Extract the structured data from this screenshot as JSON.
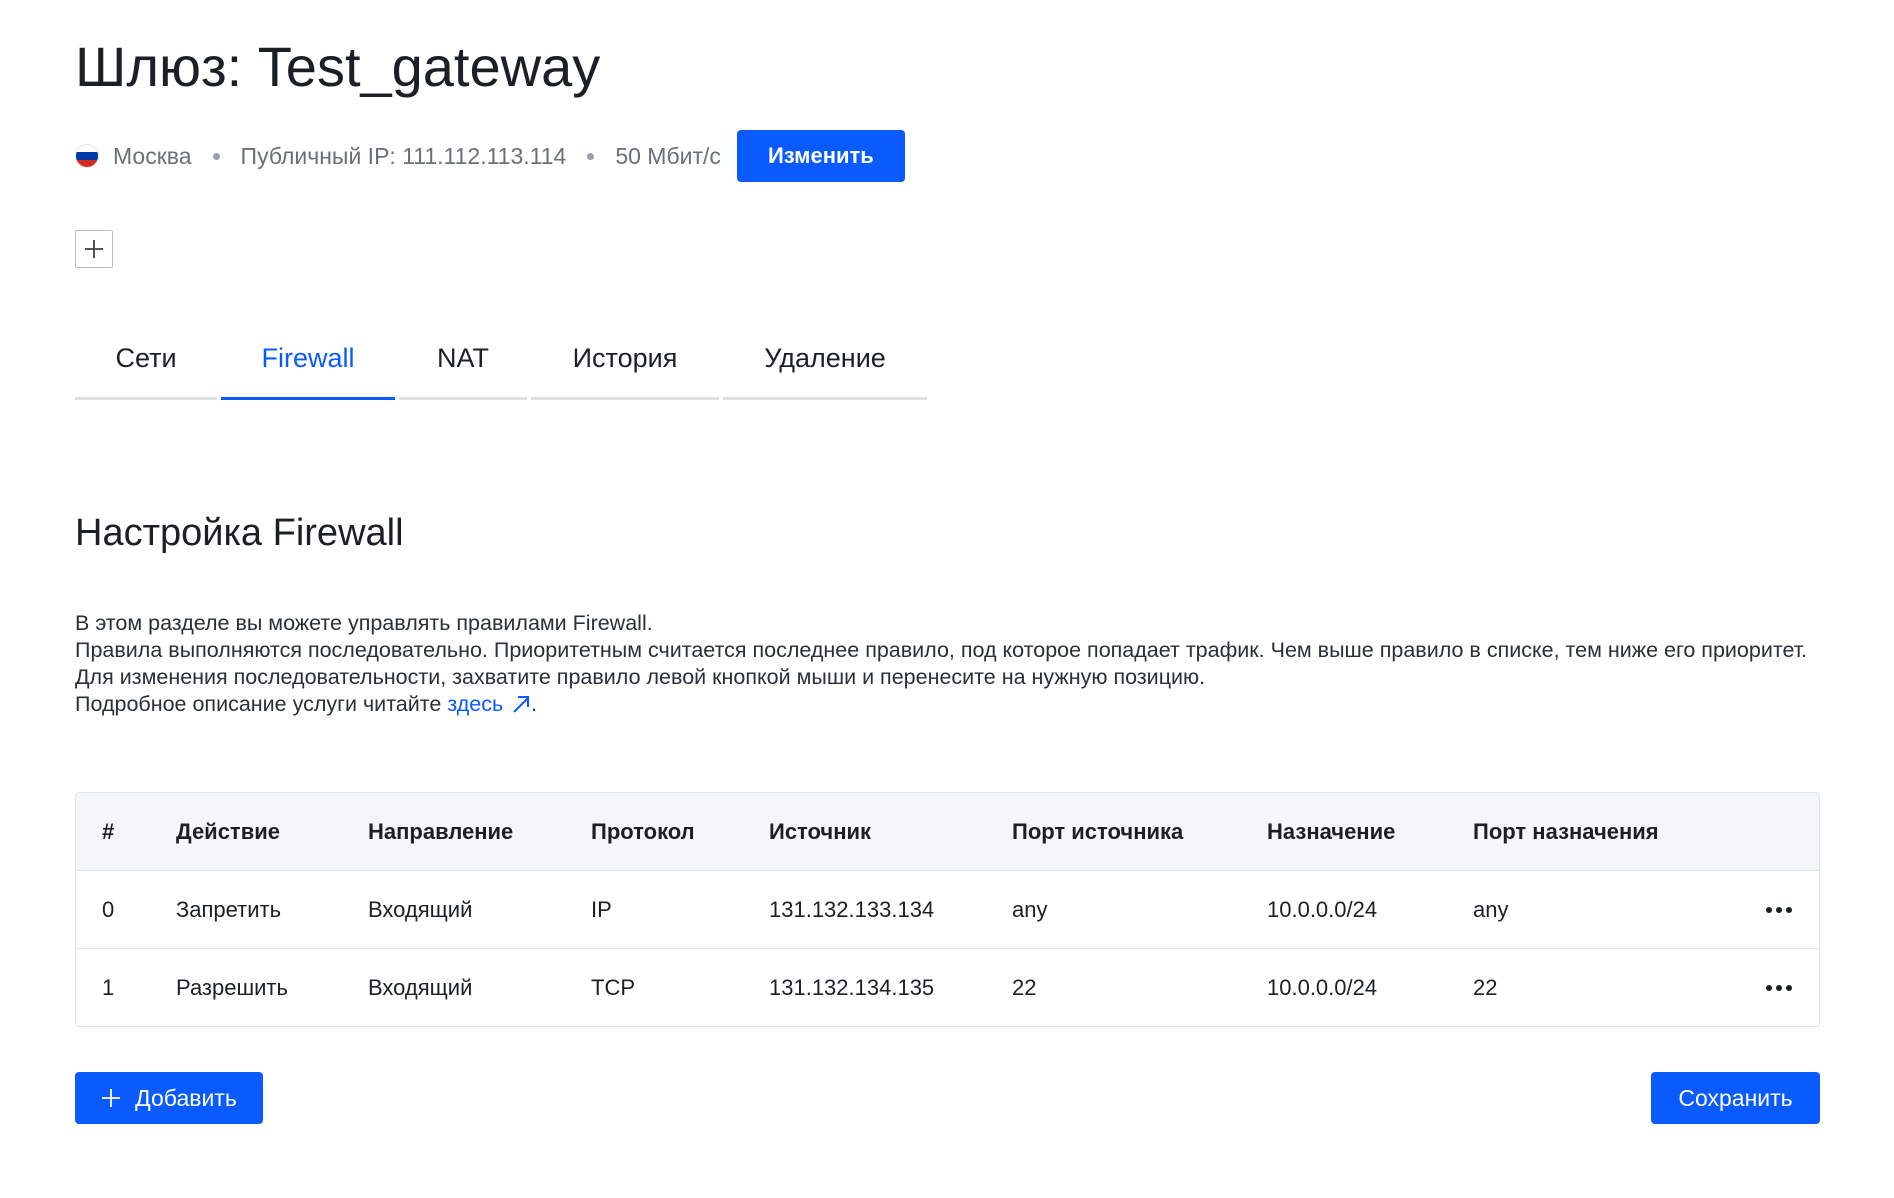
{
  "header": {
    "title": "Шлюз: Test_gateway"
  },
  "meta": {
    "location": "Москва",
    "public_ip": "Публичный IP: 111.112.113.114",
    "bandwidth": "50 Мбит/с",
    "change_label": "Изменить"
  },
  "tabs": [
    {
      "label": "Сети",
      "active": false
    },
    {
      "label": "Firewall",
      "active": true
    },
    {
      "label": "NAT",
      "active": false
    },
    {
      "label": "История",
      "active": false
    },
    {
      "label": "Удаление",
      "active": false
    }
  ],
  "section": {
    "title": "Настройка Firewall",
    "lines": [
      "В этом разделе вы можете управлять правилами Firewall.",
      "Правила выполняются последовательно. Приоритетным считается последнее правило, под которое попадает трафик. Чем выше правило в списке, тем ниже его приоритет.",
      "Для изменения последовательности, захватите правило левой кнопкой мыши и перенесите на нужную позицию."
    ],
    "more_prefix": "Подробное описание услуги читайте ",
    "more_link": "здесь",
    "more_suffix": "."
  },
  "table": {
    "columns": [
      "#",
      "Действие",
      "Направление",
      "Протокол",
      "Источник",
      "Порт источника",
      "Назначение",
      "Порт назначения"
    ],
    "rows": [
      [
        "0",
        "Запретить",
        "Входящий",
        "IP",
        "131.132.133.134",
        "any",
        "10.0.0.0/24",
        "any"
      ],
      [
        "1",
        "Разрешить",
        "Входящий",
        "TCP",
        "131.132.134.135",
        "22",
        "10.0.0.0/24",
        "22"
      ]
    ]
  },
  "actions": {
    "add_label": "Добавить",
    "save_label": "Сохранить"
  },
  "colors": {
    "accent": "#0a5bff",
    "flag": [
      "#ffffff",
      "#0039a6",
      "#d52b1e"
    ]
  }
}
